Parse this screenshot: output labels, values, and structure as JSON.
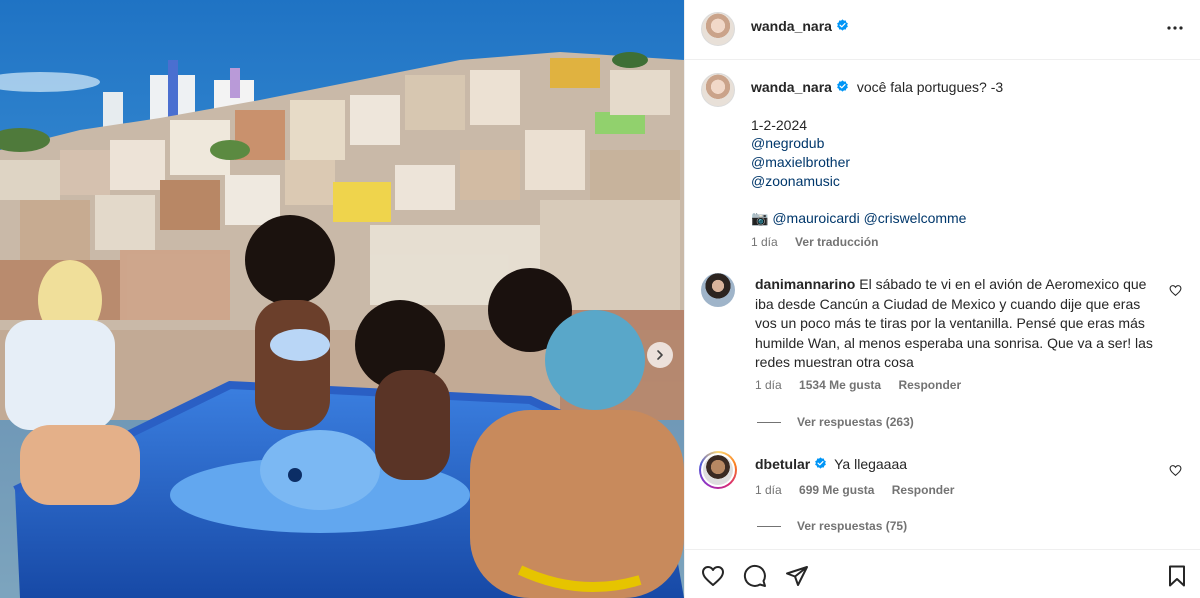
{
  "post": {
    "author": "wanda_nara",
    "caption_text": "você fala portugues? -3",
    "date_line": "1-2-2024",
    "mentions": [
      "@negrodub",
      "@maxielbrother",
      "@zoonamusic"
    ],
    "camera_glyph": "📷",
    "photo_credits": [
      "@mauroicardi",
      "@criswelcomme"
    ],
    "time": "1 día",
    "see_translation": "Ver traducción",
    "icons": {
      "verified": "verified-badge-icon",
      "more": "more-options-icon",
      "next": "chevron-right-icon"
    },
    "colors": {
      "verified": "#0095f6",
      "link": "#00376b",
      "meta": "#737373"
    }
  },
  "comments": [
    {
      "username": "danimannarino",
      "text": "El sábado te vi en el avión de Aeromexico que iba desde Cancún a Ciudad de Mexico y cuando dije que eras vos un poco más te tiras por la ventanilla. Pensé que eras más humilde Wan, al menos esperaba una sonrisa. Que va a ser! las redes muestran otra cosa",
      "time": "1 día",
      "likes": "1534 Me gusta",
      "reply": "Responder",
      "view_replies": "Ver respuestas (263)"
    },
    {
      "username": "dbetular",
      "text": "Ya llegaaaa",
      "time": "1 día",
      "likes": "699 Me gusta",
      "reply": "Responder",
      "view_replies": "Ver respuestas (75)"
    }
  ],
  "action_bar": [
    "heart-icon",
    "comment-icon",
    "share-icon",
    "bookmark-icon"
  ]
}
